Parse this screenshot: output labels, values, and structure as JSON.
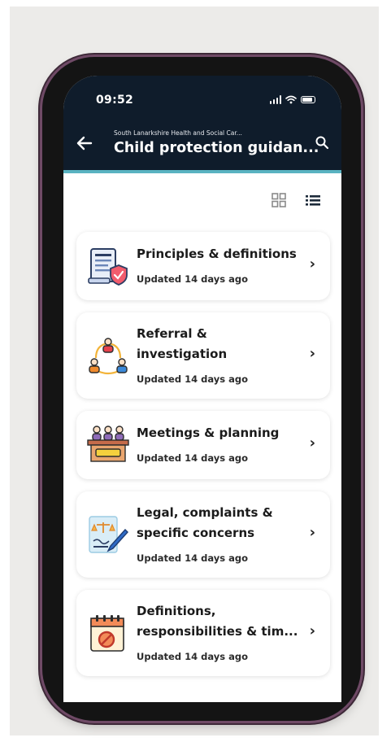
{
  "status_bar": {
    "time": "09:52"
  },
  "header": {
    "subtitle": "South Lanarkshire Health and Social Car...",
    "title": "Child protection guidan..."
  },
  "colors": {
    "header_bg": "#0f1c2b",
    "accent": "#5ab3c1",
    "phone_frame": "#6f4a66"
  },
  "view_toggle": {
    "icons": [
      "grid-view-icon",
      "list-view-icon"
    ]
  },
  "items": [
    {
      "title_lines": [
        "Principles & definitions"
      ],
      "updated": "Updated 14 days ago",
      "icon": "document-shield-icon"
    },
    {
      "title_lines": [
        "Referral &",
        "investigation"
      ],
      "updated": "Updated 14 days ago",
      "icon": "people-cycle-icon"
    },
    {
      "title_lines": [
        "Meetings & planning"
      ],
      "updated": "Updated 14 days ago",
      "icon": "meeting-table-icon"
    },
    {
      "title_lines": [
        "Legal, complaints &",
        "specific concerns"
      ],
      "updated": "Updated 14 days ago",
      "icon": "legal-document-pen-icon"
    },
    {
      "title_lines": [
        "Definitions,",
        "responsibilities & tim..."
      ],
      "updated": "Updated 14 days ago",
      "icon": "calendar-prohibited-icon"
    }
  ]
}
